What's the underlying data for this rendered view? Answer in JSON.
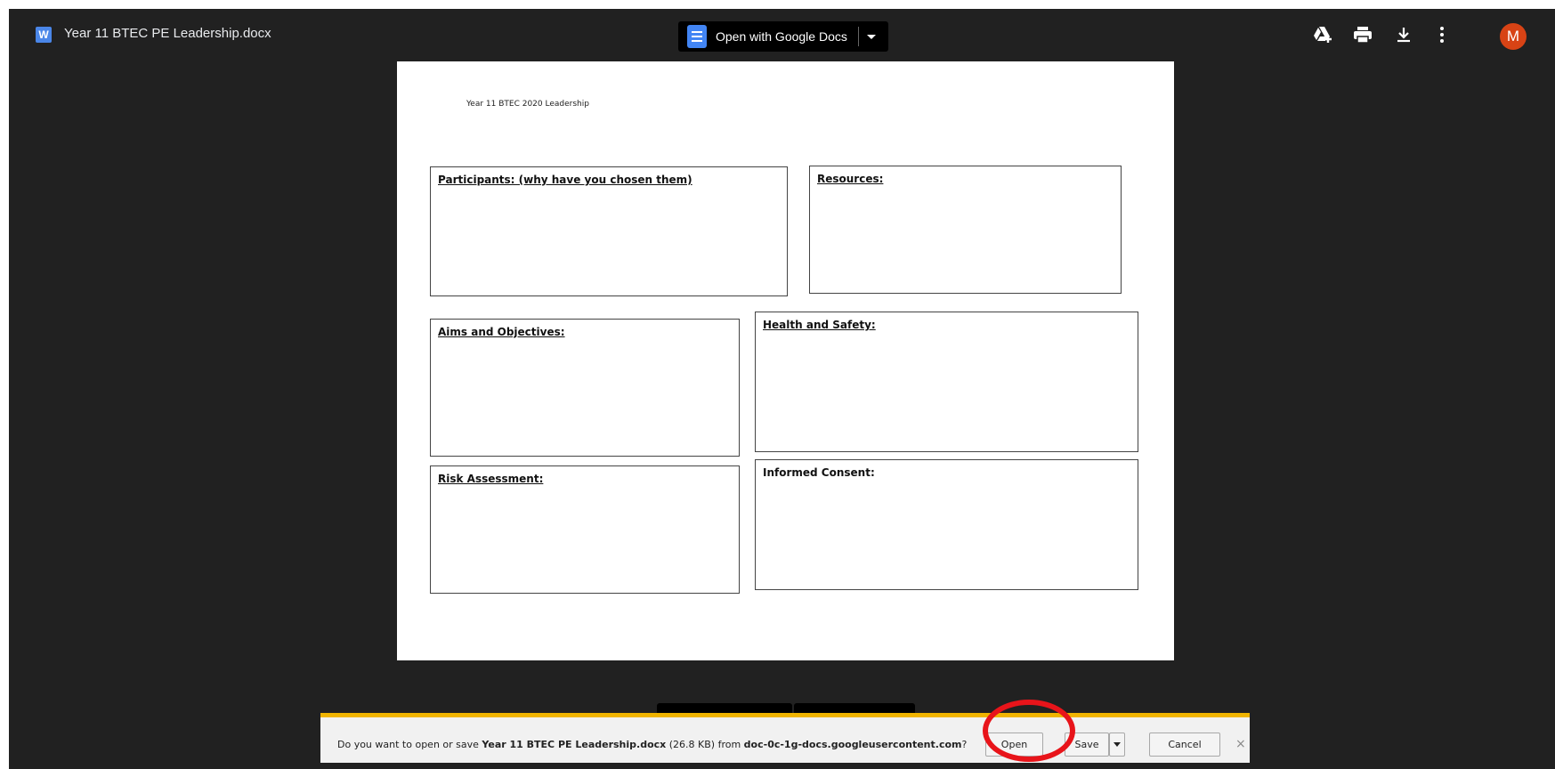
{
  "viewer": {
    "file_type_icon": "W",
    "file_name": "Year 11 BTEC PE Leadership.docx",
    "open_with_label": "Open with Google Docs",
    "toolbar_icons": [
      "add-to-drive-icon",
      "print-icon",
      "download-icon",
      "more-vert-icon"
    ],
    "avatar_letter": "M"
  },
  "document": {
    "header": "Year 11 BTEC 2020 Leadership",
    "boxes": [
      {
        "label": "Participants: (why have you chosen them)"
      },
      {
        "label": "Resources:"
      },
      {
        "label": "Aims and Objectives:"
      },
      {
        "label": "Health and Safety:"
      },
      {
        "label": "Risk Assessment:"
      },
      {
        "label": "Informed Consent:"
      }
    ]
  },
  "download_bar": {
    "prefix": "Do you want to open or save ",
    "file_name": "Year 11 BTEC PE Leadership.docx",
    "size": " (26.8 KB) from ",
    "source": "doc-0c-1g-docs.googleusercontent.com",
    "suffix": "?",
    "open_label": "Open",
    "save_label": "Save",
    "cancel_label": "Cancel",
    "close_glyph": "×"
  },
  "colors": {
    "viewer_bg": "#212121",
    "notify_accent": "#f0b400",
    "annotation_circle": "#e8141a",
    "avatar": "#d84315"
  }
}
